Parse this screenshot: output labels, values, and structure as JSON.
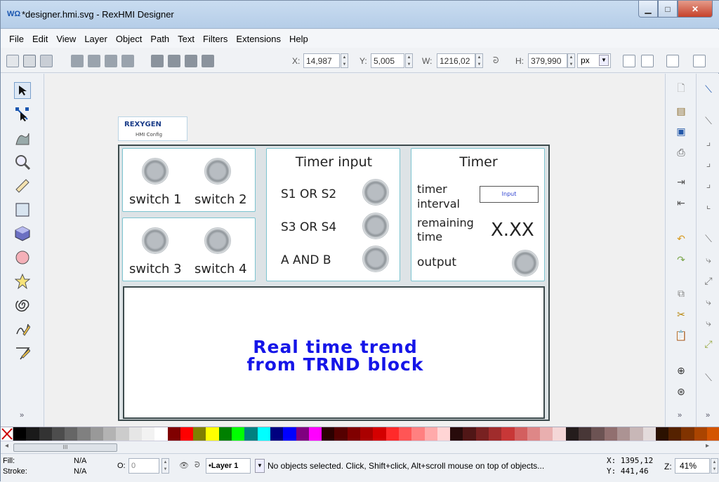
{
  "window": {
    "title": "*designer.hmi.svg - RexHMI Designer",
    "app_icon": "rexhmi-app-icon"
  },
  "menu": [
    "File",
    "Edit",
    "View",
    "Layer",
    "Object",
    "Path",
    "Text",
    "Filters",
    "Extensions",
    "Help"
  ],
  "toolbar": {
    "x_label": "X:",
    "x_value": "14,987",
    "y_label": "Y:",
    "y_value": "5,005",
    "w_label": "W:",
    "w_value": "1216,02",
    "h_label": "H:",
    "h_value": "379,990",
    "unit": "px"
  },
  "canvas": {
    "logo_brand": "REXYGEN",
    "logo_sub": "HMI Config",
    "switches": [
      "switch 1",
      "switch 2",
      "switch 3",
      "switch 4"
    ],
    "timer_input": {
      "title": "Timer input",
      "rows": [
        "S1 OR S2",
        "S3 OR S4",
        "A AND B"
      ]
    },
    "timer": {
      "title": "Timer",
      "interval_line1": "timer",
      "interval_line2": "interval",
      "input_label": "Input",
      "remaining_line1": "remaining",
      "remaining_line2": "time",
      "remaining_value": "X.XX",
      "output": "output"
    },
    "trend_line1": "Real time trend",
    "trend_line2": "from TRND block"
  },
  "status": {
    "fill_label": "Fill:",
    "fill_value": "N/A",
    "stroke_label": "Stroke:",
    "stroke_value": "N/A",
    "opacity_label": "O:",
    "opacity_value": "0",
    "layer": "•Layer 1",
    "message": "No objects selected. Click, Shift+click, Alt+scroll mouse on top of objects...",
    "cursor_x": "X: 1395,12",
    "cursor_y": "Y:  441,46",
    "zoom_label": "Z:",
    "zoom_value": "41%"
  },
  "palette": [
    "#000000",
    "#1a1a1a",
    "#333333",
    "#4d4d4d",
    "#666666",
    "#808080",
    "#999999",
    "#b3b3b3",
    "#cccccc",
    "#e6e6e6",
    "#f2f2f2",
    "#ffffff",
    "#800000",
    "#ff0000",
    "#808000",
    "#ffff00",
    "#008000",
    "#00ff00",
    "#008080",
    "#00ffff",
    "#000080",
    "#0000ff",
    "#800080",
    "#ff00ff",
    "#2b0000",
    "#550000",
    "#800000",
    "#aa0000",
    "#d40000",
    "#ff2a2a",
    "#ff5555",
    "#ff8080",
    "#ffaaaa",
    "#ffd5d5",
    "#280b0b",
    "#501616",
    "#782121",
    "#a02c2c",
    "#c83737",
    "#d35f5f",
    "#de8787",
    "#e9afaf",
    "#f4d7d7",
    "#241c1c",
    "#483737",
    "#6c5353",
    "#916f6f",
    "#ac9393",
    "#c8b7b7",
    "#e3dbdb",
    "#2b1100",
    "#552200",
    "#803300",
    "#aa4400",
    "#d45500"
  ]
}
